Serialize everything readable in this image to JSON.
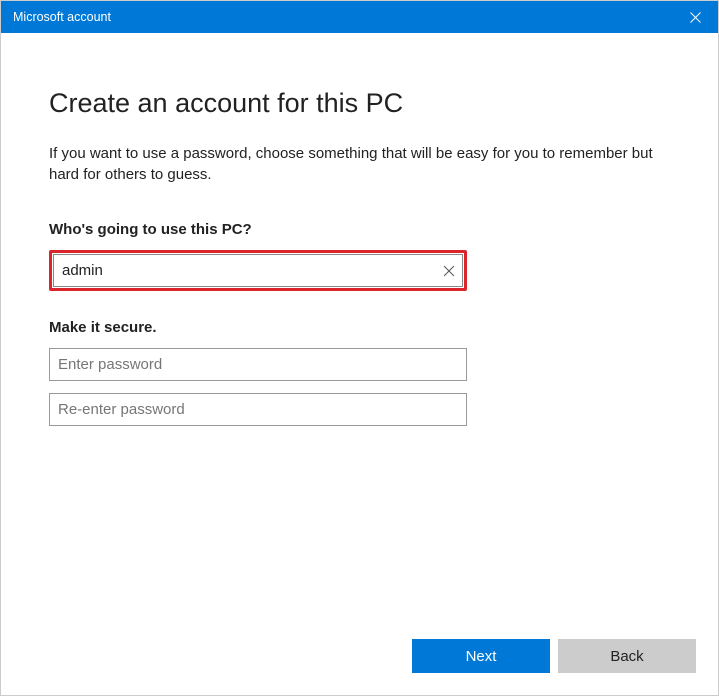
{
  "titlebar": {
    "title": "Microsoft account"
  },
  "main": {
    "heading": "Create an account for this PC",
    "subtext": "If you want to use a password, choose something that will be easy for you to remember but hard for others to guess.",
    "username_section_label": "Who's going to use this PC?",
    "username_value": "admin",
    "password_section_label": "Make it secure.",
    "password_placeholder": "Enter password",
    "confirm_placeholder": "Re-enter password"
  },
  "footer": {
    "next_label": "Next",
    "back_label": "Back"
  },
  "colors": {
    "accent": "#0078d7",
    "highlight_border": "#d9252b"
  }
}
